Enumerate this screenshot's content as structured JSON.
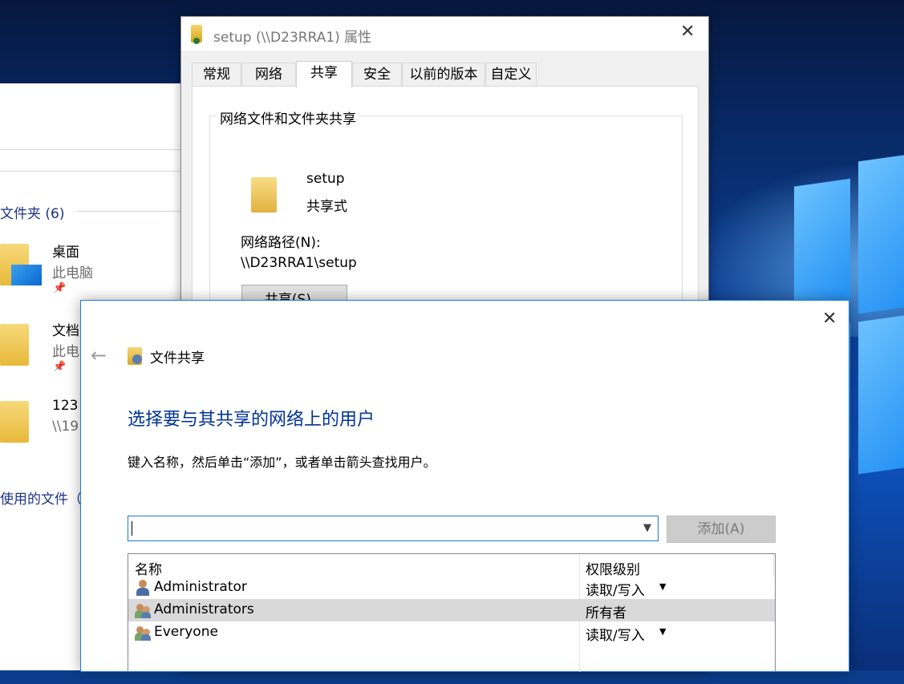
{
  "explorer": {
    "folders_header": "文件夹 (6)",
    "items": [
      {
        "title": "桌面",
        "subtitle": "此电脑"
      },
      {
        "title": "文档",
        "subtitle": "此电"
      },
      {
        "title": "123",
        "subtitle": "\\\\19"
      }
    ],
    "recent_header": "使用的文件（"
  },
  "properties": {
    "title": "setup (\\\\D23RRA1) 属性",
    "tabs": [
      "常规",
      "网络",
      "共享",
      "安全",
      "以前的版本",
      "自定义"
    ],
    "active_tab": "共享",
    "group_label": "网络文件和文件夹共享",
    "share_name": "setup",
    "share_state": "共享式",
    "network_path_label": "网络路径(N):",
    "network_path": "\\\\D23RRA1\\setup",
    "share_button": "共享(S)..."
  },
  "wizard": {
    "window_title": "文件共享",
    "heading": "选择要与其共享的网络上的用户",
    "instruction": "键入名称，然后单击“添加”，或者单击箭头查找用户。",
    "input_value": "",
    "add_button": "添加(A)",
    "columns": [
      "名称",
      "权限级别"
    ],
    "rows": [
      {
        "name": "Administrator",
        "permission": "读取/写入",
        "icon": "user-icon",
        "has_dropdown": true
      },
      {
        "name": "Administrators",
        "permission": "所有者",
        "icon": "group-icon",
        "has_dropdown": false,
        "selected": true
      },
      {
        "name": "Everyone",
        "permission": "读取/写入",
        "icon": "group-icon",
        "has_dropdown": true
      }
    ]
  }
}
